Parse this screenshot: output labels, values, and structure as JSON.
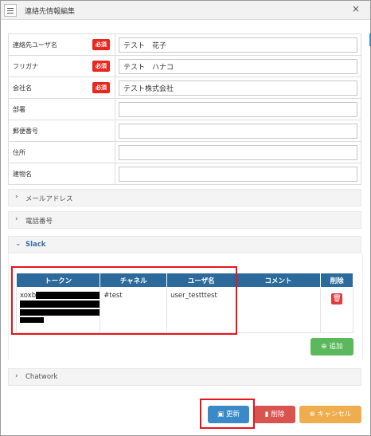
{
  "window": {
    "title": "連絡先情報編集",
    "close_label": "×"
  },
  "form": {
    "rows": [
      {
        "label": "連絡先ユーザ名",
        "required": true,
        "value": "テスト　花子"
      },
      {
        "label": "フリガナ",
        "required": true,
        "value": "テスト　ハナコ"
      },
      {
        "label": "会社名",
        "required": true,
        "value": "テスト株式会社"
      },
      {
        "label": "部署",
        "required": false,
        "value": ""
      },
      {
        "label": "郵便番号",
        "required": false,
        "value": ""
      },
      {
        "label": "住所",
        "required": false,
        "value": ""
      },
      {
        "label": "建物名",
        "required": false,
        "value": ""
      }
    ],
    "required_label": "必須"
  },
  "sections": {
    "mail": "メールアドレス",
    "phone": "電話番号",
    "slack": "Slack",
    "chatwork": "Chatwork"
  },
  "slack_table": {
    "headers": [
      "トークン",
      "チャネル",
      "ユーザ名",
      "コメント",
      "削除"
    ],
    "row": {
      "token": "xoxb",
      "channel": "#test",
      "username": "user_testttest",
      "comment": ""
    }
  },
  "buttons": {
    "add": "追加",
    "update": "更新",
    "delete": "削除",
    "cancel": "キャンセル"
  },
  "colors": {
    "header_blue": "#2b6a9a",
    "required_red": "#e8281f",
    "highlight_red": "#e8141d",
    "add_green": "#5cb85c",
    "update_blue": "#3a8ac9",
    "delete_red": "#d9534f",
    "cancel_orange": "#f0ad4e"
  }
}
